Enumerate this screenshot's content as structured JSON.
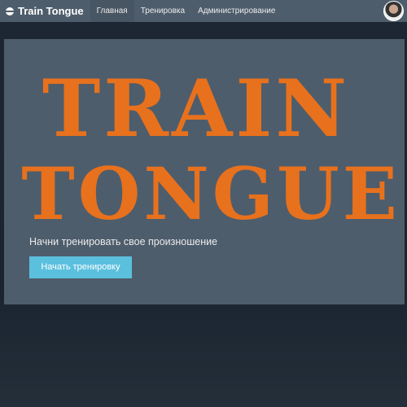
{
  "nav": {
    "brand": "Train Tongue",
    "items": [
      {
        "label": "Главная",
        "active": true
      },
      {
        "label": "Тренировка"
      },
      {
        "label": "Администрирование"
      }
    ]
  },
  "hero": {
    "logo_line1": "TRAIN",
    "logo_line2": "TONGUE",
    "tagline": "Начни тренировать свое произношение",
    "button": "Начать тренировку"
  },
  "colors": {
    "navbar": "#4e5d6c",
    "accent": "#e8711d",
    "button": "#5bc0de"
  }
}
